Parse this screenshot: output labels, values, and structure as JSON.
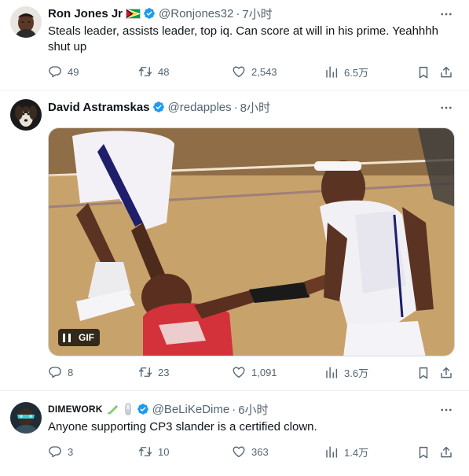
{
  "tweets": [
    {
      "name": "Ron Jones Jr",
      "handle": "@Ronjones32",
      "time": "7小时",
      "text": "Steals leader, assists leader, top iq. Can score at will in his prime. Yeahhhh shut up",
      "replies": "49",
      "retweets": "48",
      "likes": "2,543",
      "views": "6.5万"
    },
    {
      "name": "David Astramskas",
      "handle": "@redapples",
      "time": "8小时",
      "media_badge": "GIF",
      "replies": "8",
      "retweets": "23",
      "likes": "1,091",
      "views": "3.6万"
    },
    {
      "name": "DIMEWORK",
      "handle": "@BeLiKeDime",
      "time": "6小时",
      "text": "Anyone supporting CP3 slander is a certified clown.",
      "replies": "3",
      "retweets": "10",
      "likes": "363",
      "views": "1.4万"
    }
  ],
  "separator": "·",
  "icons": {
    "verified": "verified-badge-icon",
    "more": "more-dots-icon",
    "reply": "reply-icon",
    "retweet": "retweet-icon",
    "like": "heart-icon",
    "views": "views-bar-icon",
    "bookmark": "bookmark-icon",
    "share": "share-icon",
    "pause": "pause-icon"
  },
  "colors": {
    "text": "#0f1419",
    "secondary": "#536471",
    "verified": "#1d9bf0",
    "divider": "#eff3f4"
  }
}
